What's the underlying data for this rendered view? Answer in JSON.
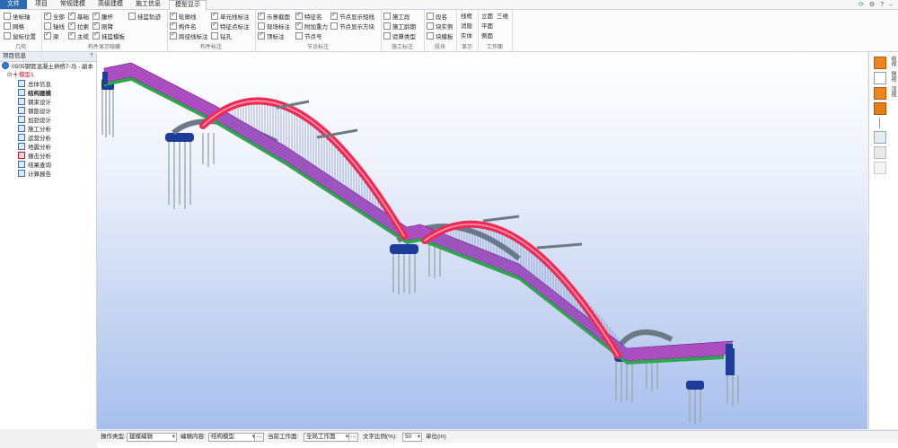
{
  "menu": {
    "file": "文件",
    "tabs": [
      "项目",
      "常规建模",
      "高级建模",
      "施工信息",
      "模型显示"
    ]
  },
  "ribbon": {
    "group1": {
      "title": "几何",
      "items": [
        {
          "label": "坐标轴",
          "checked": false
        },
        {
          "label": "网格",
          "checked": false
        },
        {
          "label": "鼠标位置",
          "checked": false
        },
        {
          "label": "轴线",
          "checked": false
        },
        {
          "label": "梁",
          "checked": true
        }
      ]
    },
    "group2": {
      "title": "构件显示隐藏",
      "items": [
        {
          "label": "全部",
          "checked": true
        },
        {
          "label": "基础",
          "checked": true
        },
        {
          "label": "腹杆",
          "checked": true
        },
        {
          "label": "拉索",
          "checked": true
        },
        {
          "label": "刚臂",
          "checked": true
        },
        {
          "label": "主缆",
          "checked": true
        },
        {
          "label": "挂篮模板",
          "checked": true
        },
        {
          "label": "挂篮轨迹",
          "checked": false
        }
      ]
    },
    "group3": {
      "title": "构件标注",
      "items": [
        {
          "label": "轮廓线",
          "checked": true
        },
        {
          "label": "单元线标注",
          "checked": true
        },
        {
          "label": "构件名",
          "checked": true
        },
        {
          "label": "特征点标注",
          "checked": true
        },
        {
          "label": "跨径线标注",
          "checked": true
        },
        {
          "label": "钻孔",
          "checked": false
        }
      ]
    },
    "group4": {
      "title": "节点标注",
      "items": [
        {
          "label": "示意截面",
          "checked": true
        },
        {
          "label": "特征名",
          "checked": true
        },
        {
          "label": "节点显示短线",
          "checked": true
        },
        {
          "label": "现场标注",
          "checked": false
        },
        {
          "label": "附加重力",
          "checked": true
        },
        {
          "label": "节点显示方块",
          "checked": false
        },
        {
          "label": "顶标注",
          "checked": true
        },
        {
          "label": "节点号",
          "checked": false
        }
      ]
    },
    "group5": {
      "title": "施工标注",
      "items": [
        {
          "label": "施工段",
          "checked": false
        },
        {
          "label": "施工龄期",
          "checked": false
        },
        {
          "label": "验算类型",
          "checked": false
        }
      ]
    },
    "group6": {
      "title": "段块",
      "items": [
        {
          "label": "段名",
          "checked": false
        },
        {
          "label": "块实例",
          "checked": false
        },
        {
          "label": "块模板",
          "checked": false
        }
      ]
    },
    "group7": {
      "title": "显示",
      "items": [
        "线框",
        "消隐",
        "实体"
      ]
    },
    "group8": {
      "title": "工作面",
      "items": [
        "立面",
        "三维",
        "平面",
        "侧面"
      ]
    }
  },
  "panel": {
    "title": "项目信息",
    "project": "0505钢管混凝土拱桥7-马 - 副本",
    "model": "模型1",
    "nodes": [
      "总体信息",
      "结构建模",
      "钢束设计",
      "钢筋设计",
      "加劲设计",
      "施工分析",
      "运营分析",
      "地震分析",
      "撞击分析",
      "结果查询",
      "计算报告"
    ]
  },
  "right_tools": [
    "前视",
    "侧视",
    "顶视"
  ],
  "status": {
    "op_type_label": "操作类型:",
    "op_type_value": "建模编辑",
    "edit_label": "编辑内容:",
    "edit_value": "结构模型",
    "workplane_label": "当前工作面:",
    "workplane_value": "全局工作面",
    "text_ratio_label": "文字比例(%):",
    "text_ratio_value": "50",
    "unit_label": "单位(m)"
  },
  "colors": {
    "deck": "#b355c8",
    "arch": "#ee2b55",
    "pier": "#1e3c9a",
    "bearing": "#22a04a",
    "accent": "#2b6cb3"
  }
}
